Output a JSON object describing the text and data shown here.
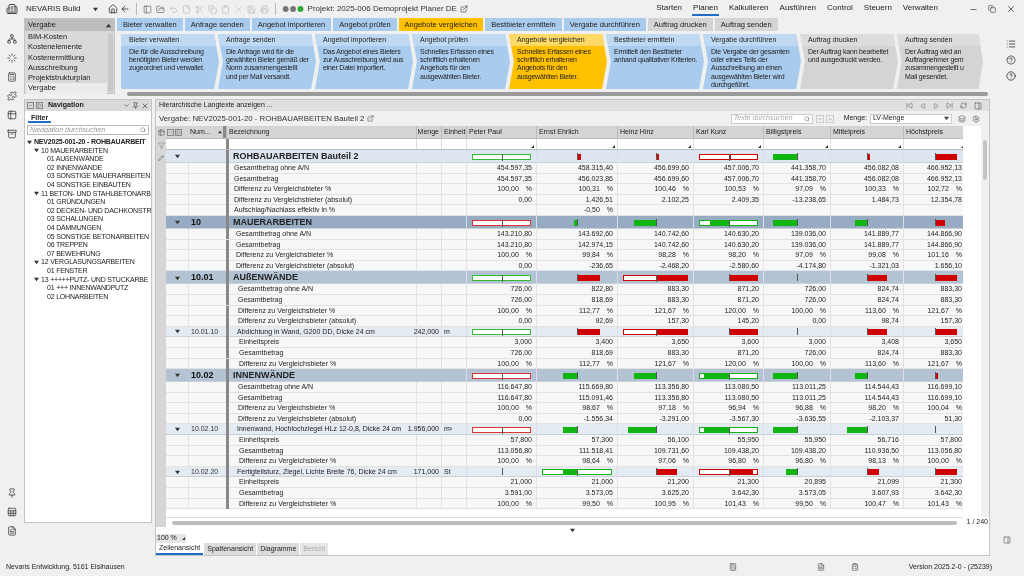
{
  "app": {
    "title": "NEVARIS Build",
    "project": "Projekt: 2025-006 Demoprojekt Planer DE"
  },
  "menu": [
    {
      "label": "Starten",
      "selected": false
    },
    {
      "label": "Planen",
      "selected": true
    },
    {
      "label": "Kalkulieren",
      "selected": false
    },
    {
      "label": "Ausführen",
      "selected": false
    },
    {
      "label": "Control",
      "selected": false
    },
    {
      "label": "Steuern",
      "selected": false
    },
    {
      "label": "Verwalten",
      "selected": false
    }
  ],
  "modules": {
    "header": "Vergabe",
    "items": [
      {
        "label": "BIM-Kosten",
        "selected": false
      },
      {
        "label": "Kostenelemente",
        "selected": false
      },
      {
        "label": "Kostenermittlung",
        "selected": false
      },
      {
        "label": "Ausschreibung",
        "selected": false
      },
      {
        "label": "Projektstrukturplan",
        "selected": false
      },
      {
        "label": "Vergabe",
        "selected": true
      }
    ]
  },
  "workflow_tabs": [
    {
      "label": "Bieter verwalten",
      "selected": false,
      "available": true
    },
    {
      "label": "Anfrage senden",
      "selected": false,
      "available": true
    },
    {
      "label": "Angebot importieren",
      "selected": false,
      "available": true
    },
    {
      "label": "Angebot prüfen",
      "selected": false,
      "available": true
    },
    {
      "label": "Angebote vergleichen",
      "selected": true,
      "available": true
    },
    {
      "label": "Bestbieter ermitteln",
      "selected": false,
      "available": true
    },
    {
      "label": "Vergabe durchführen",
      "selected": false,
      "available": true
    },
    {
      "label": "Auftrag drucken",
      "selected": false,
      "available": false
    },
    {
      "label": "Auftrag senden",
      "selected": false,
      "available": false
    }
  ],
  "workflow_steps": [
    {
      "title": "Bieter verwalten",
      "description": "Die für die Ausschreibung benötigten Bieter werden zugeordnet und verwaltet.",
      "selected": false,
      "available": true
    },
    {
      "title": "Anfrage senden",
      "description": "Die Anfrage wird für die gewählten Bieter gemäß der Norm zusammengestellt und per Mail versandt.",
      "selected": false,
      "available": true
    },
    {
      "title": "Angebot importieren",
      "description": "Das Angebot eines Bieters zur Ausschreibung wird aus einer Datei importiert.",
      "selected": false,
      "available": true
    },
    {
      "title": "Angebot prüfen",
      "description": "Schnelles Erfassen eines schriftlich erhaltenen Angebots für den ausgewählten Bieter.",
      "selected": false,
      "available": true
    },
    {
      "title": "Angebote vergleichen",
      "description": "Schnelles Erfassen eines schriftlich erhaltenen Angebots für den ausgewählten Bieter.",
      "selected": true,
      "available": true
    },
    {
      "title": "Bestbieter ermitteln",
      "description": "Ermittelt den Bestbieter anhand qualitativer Kriterien.",
      "selected": false,
      "available": true
    },
    {
      "title": "Vergabe durchführen",
      "description": "Die Vergabe der gesamten oder eines Teils der Ausschreibung an einen ausgewählten Bieter wird durchgeführt.",
      "selected": false,
      "available": true
    },
    {
      "title": "Auftrag drucken",
      "description": "Der Auftrag kann bearbeitet und ausgedruckt werden.",
      "selected": false,
      "available": false
    },
    {
      "title": "Auftrag senden",
      "description": "Der Auftrag wird an Auftragnehmer gem zusammengestellt u Mail gesendet.",
      "selected": false,
      "available": false
    }
  ],
  "navigation": {
    "title": "Navigation",
    "tab": "Filter",
    "placeholder": "Navigation durchsuchen",
    "tree": [
      {
        "label": "NEV2025-001-20 - ROHBAUARBEIT",
        "expanded": true,
        "children": [
          {
            "label": "10 MAUERARBEITEN",
            "expanded": true,
            "children": [
              {
                "label": "01 AUßENWÄNDE"
              },
              {
                "label": "02 INNENWÄNDE"
              },
              {
                "label": "03 SONSTIGE MAUERARBEITEN"
              },
              {
                "label": "04 SONSTIGE EINBAUTEN"
              }
            ]
          },
          {
            "label": "11 BETON- UND STAHLBETONARB",
            "expanded": true,
            "children": [
              {
                "label": "01 GRÜNDUNGEN"
              },
              {
                "label": "02 DECKEN- UND DACHKONSTR"
              },
              {
                "label": "03 SCHALUNGEN"
              },
              {
                "label": "04 DÄMMUNGEN"
              },
              {
                "label": "05 SONSTIGE BETONARBEITEN"
              },
              {
                "label": "06 TREPPEN"
              },
              {
                "label": "07 BEWEHRUNG"
              }
            ]
          },
          {
            "label": "12 VERGLASUNGSARBEITEN",
            "expanded": true,
            "children": [
              {
                "label": "01 FENSTER"
              }
            ]
          },
          {
            "label": "13 +++++PUTZ- UND STUCKARBE",
            "expanded": true,
            "children": [
              {
                "label": "01 +++ INNENWANDPUTZ"
              },
              {
                "label": "02 LOHNARBEITEN"
              }
            ]
          }
        ]
      }
    ]
  },
  "main": {
    "toolbar_link": "Hierarchische Langtexte anzeigen ...",
    "title": "Vergabe: NEV2025-001-20 - ROHBAUARBEITEN Bauteil 2",
    "search_placeholder": "Texte durchsuchen",
    "quantity_label": "Menge:",
    "quantity_value": "LV-Menge",
    "page": "1 / 240",
    "zoom": "100 %",
    "tabs": [
      {
        "label": "Zeilenansicht",
        "selected": true,
        "disabled": false
      },
      {
        "label": "Spaltenansicht",
        "selected": false,
        "disabled": false
      },
      {
        "label": "Diagramme",
        "selected": false,
        "disabled": false
      },
      {
        "label": "Bericht",
        "selected": false,
        "disabled": true
      }
    ]
  },
  "table": {
    "columns": [
      "Num...",
      "Bezeichnung",
      "Menge",
      "Einheit",
      "Peter Paul",
      "Ernst Ehrlich",
      "Heinz Hinz",
      "Karl Kunz",
      "Billigstpreis",
      "Mittelpreis",
      "Höchstpreis"
    ],
    "rows": [
      {
        "kind": "group",
        "number": "",
        "label": "ROHBAUARBEITEN Bauteil 2",
        "bars": [
          {
            "kind": "reference",
            "color": "#33bb33"
          },
          {
            "kind": "above_tiny"
          },
          {
            "kind": "above_tiny"
          },
          {
            "kind": "above_tiny_outlined"
          },
          {
            "kind": "below_large"
          },
          {
            "kind": "above_tiny"
          },
          {
            "kind": "above_large"
          }
        ],
        "lines": [
          {
            "label": "Gesamtbetrag ohne A/N",
            "values": [
              "454.597,35",
              "458.315,40",
              "456.699,60",
              "457.006,70",
              "441.358,70",
              "456.082,08",
              "466.952,13"
            ]
          },
          {
            "label": "Gesamtbetrag",
            "values": [
              "454.597,35",
              "456.023,86",
              "456.699,60",
              "457.006,70",
              "441.358,70",
              "456.082,08",
              "466.952,13"
            ]
          },
          {
            "label": "Differenz zu Vergleichsbieter %",
            "values": [
              "100,00 %",
              "100,31 %",
              "100,46 %",
              "100,53 %",
              "97,09 %",
              "100,33 %",
              "102,72 %"
            ]
          },
          {
            "label": "Differenz zu Vergleichsbieter (absolut)",
            "values": [
              "0,00",
              "1.426,51",
              "2.102,25",
              "2.409,35",
              "-13.238,65",
              "1.484,73",
              "12.354,78"
            ]
          },
          {
            "label": "Aufschlag/Nachlass effektiv in %",
            "kind": "second_column_only",
            "value": "-0,50 %"
          }
        ],
        "children": [
          {
            "kind": "group",
            "number": "10",
            "label": "MAUERARBEITEN",
            "bars": [
              {
                "kind": "reference",
                "color": "#dd3333"
              },
              {
                "kind": "below_tiny"
              },
              {
                "kind": "below_medium"
              },
              {
                "kind": "below_medium_outlined"
              },
              {
                "kind": "below_large"
              },
              {
                "kind": "below_small"
              },
              {
                "kind": "above_small"
              }
            ],
            "lines": [
              {
                "label": "Gesamtbetrag ohne A/N",
                "values": [
                  "143.210,80",
                  "143.692,60",
                  "140.742,60",
                  "140.630,20",
                  "139.036,00",
                  "141.889,77",
                  "144.866,90"
                ]
              },
              {
                "label": "Gesamtbetrag",
                "values": [
                  "143.210,80",
                  "142.974,15",
                  "140.742,60",
                  "140.630,20",
                  "139.036,00",
                  "141.889,77",
                  "144.866,90"
                ]
              },
              {
                "label": "Differenz zu Vergleichsbieter %",
                "values": [
                  "100,00 %",
                  "99,84 %",
                  "98,28 %",
                  "98,20 %",
                  "97,09 %",
                  "99,08 %",
                  "101,16 %"
                ]
              },
              {
                "label": "Differenz zu Vergleichsbieter (absolut)",
                "values": [
                  "0,00",
                  "-236,65",
                  "-2.468,20",
                  "-2.580,60",
                  "-4.174,80",
                  "-1.321,03",
                  "1.656,10"
                ]
              }
            ],
            "children": [
              {
                "kind": "group",
                "number": "10.01",
                "label": "AUßENWÄNDE",
                "bars": [
                  {
                    "kind": "reference",
                    "color": "#33bb33"
                  },
                  {
                    "kind": "above_medium"
                  },
                  {
                    "kind": "above_full_outlined"
                  },
                  {
                    "kind": "above_full"
                  },
                  {
                    "kind": "tick"
                  },
                  {
                    "kind": "above_medium"
                  },
                  {
                    "kind": "above_large"
                  }
                ],
                "lines": [
                  {
                    "label": "Gesamtbetrag ohne A/N",
                    "values": [
                      "726,00",
                      "822,80",
                      "883,30",
                      "871,20",
                      "726,00",
                      "824,74",
                      "883,30"
                    ]
                  },
                  {
                    "label": "Gesamtbetrag",
                    "values": [
                      "726,00",
                      "818,69",
                      "883,30",
                      "871,20",
                      "726,00",
                      "824,74",
                      "883,30"
                    ]
                  },
                  {
                    "label": "Differenz zu Vergleichsbieter %",
                    "values": [
                      "100,00 %",
                      "112,77 %",
                      "121,67 %",
                      "120,00 %",
                      "100,00 %",
                      "113,60 %",
                      "121,67 %"
                    ]
                  },
                  {
                    "label": "Differenz zu Vergleichsbieter (absolut)",
                    "values": [
                      "0,00",
                      "92,69",
                      "157,30",
                      "145,20",
                      "0,00",
                      "98,74",
                      "157,30"
                    ]
                  }
                ],
                "children": [
                  {
                    "kind": "position",
                    "number": "10.01.10",
                    "label": "Abdichtung in Wand, G200 DD, Dicke 24 cm",
                    "quantity": "242,000",
                    "unit": "m",
                    "bars": [
                      {
                        "kind": "reference",
                        "color": "#33bb33"
                      },
                      {
                        "kind": "above_medium"
                      },
                      {
                        "kind": "above_full_outlined"
                      },
                      {
                        "kind": "above_full"
                      },
                      {
                        "kind": "tick"
                      },
                      {
                        "kind": "above_medium"
                      },
                      {
                        "kind": "above_large"
                      }
                    ],
                    "lines": [
                      {
                        "label": "Einheitspreis",
                        "values": [
                          "3,000",
                          "3,400",
                          "3,650",
                          "3,600",
                          "3,000",
                          "3,408",
                          "3,650"
                        ]
                      },
                      {
                        "label": "Gesamtbetrag",
                        "values": [
                          "726,00",
                          "818,69",
                          "883,30",
                          "871,20",
                          "726,00",
                          "824,74",
                          "883,30"
                        ]
                      },
                      {
                        "label": "Differenz zu Vergleichsbieter %",
                        "values": [
                          "100,00 %",
                          "112,77 %",
                          "121,67 %",
                          "120,00 %",
                          "100,00 %",
                          "113,60 %",
                          "121,67 %"
                        ]
                      }
                    ]
                  }
                ]
              },
              {
                "kind": "group",
                "number": "10.02",
                "label": "INNENWÄNDE",
                "bars": [
                  {
                    "kind": "reference",
                    "color": "#dd3333"
                  },
                  {
                    "kind": "below_small"
                  },
                  {
                    "kind": "below_medium"
                  },
                  {
                    "kind": "below_large_outlined"
                  },
                  {
                    "kind": "below_large"
                  },
                  {
                    "kind": "below_small"
                  },
                  {
                    "kind": "above_tiny"
                  }
                ],
                "lines": [
                  {
                    "label": "Gesamtbetrag ohne A/N",
                    "values": [
                      "116.647,80",
                      "115.669,80",
                      "113.356,80",
                      "113.080,50",
                      "113.011,25",
                      "114.544,43",
                      "116.699,10"
                    ]
                  },
                  {
                    "label": "Gesamtbetrag",
                    "values": [
                      "116.647,80",
                      "115.091,46",
                      "113.356,80",
                      "113.080,50",
                      "113.011,25",
                      "114.544,43",
                      "116.699,10"
                    ]
                  },
                  {
                    "label": "Differenz zu Vergleichsbieter %",
                    "values": [
                      "100,00 %",
                      "98,67 %",
                      "97,18 %",
                      "96,94 %",
                      "96,88 %",
                      "98,20 %",
                      "100,04 %"
                    ]
                  },
                  {
                    "label": "Differenz zu Vergleichsbieter (absolut)",
                    "values": [
                      "0,00",
                      "-1.556,34",
                      "-3.291,00",
                      "-3.567,30",
                      "-3.636,55",
                      "-2.103,37",
                      "51,30"
                    ]
                  }
                ],
                "children": [
                  {
                    "kind": "position",
                    "number": "10.02.10",
                    "label": "Innenwand, Hochlochziegel HLz 12-0,8, Dicke 24 cm",
                    "quantity": "1.956,000",
                    "unit": "m²",
                    "bars": [
                      {
                        "kind": "reference",
                        "color": "#dd3333"
                      },
                      {
                        "kind": "below_small"
                      },
                      {
                        "kind": "below_large"
                      },
                      {
                        "kind": "below_large_outlined"
                      },
                      {
                        "kind": "below_large"
                      },
                      {
                        "kind": "below_medium"
                      },
                      {
                        "kind": "tick"
                      }
                    ],
                    "lines": [
                      {
                        "label": "Einheitspreis",
                        "values": [
                          "57,800",
                          "57,300",
                          "56,100",
                          "55,950",
                          "55,950",
                          "56,716",
                          "57,800"
                        ]
                      },
                      {
                        "label": "Gesamtbetrag",
                        "values": [
                          "113.056,80",
                          "111.518,41",
                          "109.731,60",
                          "109.438,20",
                          "109.438,20",
                          "110.936,50",
                          "113.056,80"
                        ]
                      },
                      {
                        "label": "Differenz zu Vergleichsbieter %",
                        "values": [
                          "100,00 %",
                          "98,64 %",
                          "97,06 %",
                          "96,80 %",
                          "96,80 %",
                          "98,13 %",
                          "100,00 %"
                        ]
                      }
                    ]
                  },
                  {
                    "kind": "position",
                    "number": "10.02.20",
                    "label": "Fertigteilsturz, Ziegel, Lichte Breite 76, Dicke 24 cm",
                    "quantity": "171,000",
                    "unit": "St",
                    "bars": [
                      {
                        "kind": "tick"
                      },
                      {
                        "kind": "below_small_outlined"
                      },
                      {
                        "kind": "above_medium"
                      },
                      {
                        "kind": "above_large_outlined"
                      },
                      {
                        "kind": "below_small"
                      },
                      {
                        "kind": "above_small"
                      },
                      {
                        "kind": "above_large"
                      }
                    ],
                    "lines": [
                      {
                        "label": "Einheitspreis",
                        "values": [
                          "21,000",
                          "21,000",
                          "21,200",
                          "21,300",
                          "20,895",
                          "21,099",
                          "21,300"
                        ]
                      },
                      {
                        "label": "Gesamtbetrag",
                        "values": [
                          "3.591,00",
                          "3.573,05",
                          "3.625,20",
                          "3.642,30",
                          "3.573,05",
                          "3.607,93",
                          "3.642,30"
                        ]
                      },
                      {
                        "label": "Differenz zu Vergleichsbieter %",
                        "values": [
                          "100,00 %",
                          "99,50 %",
                          "100,95 %",
                          "101,43 %",
                          "99,50 %",
                          "100,47 %",
                          "101,43 %"
                        ]
                      }
                    ]
                  }
                ]
              }
            ]
          }
        ]
      }
    ]
  },
  "status_bar": {
    "left": "Nevaris Entwicklung, 5161 Elsihausen",
    "version": "Version 2025.2-0 - (25239)"
  }
}
